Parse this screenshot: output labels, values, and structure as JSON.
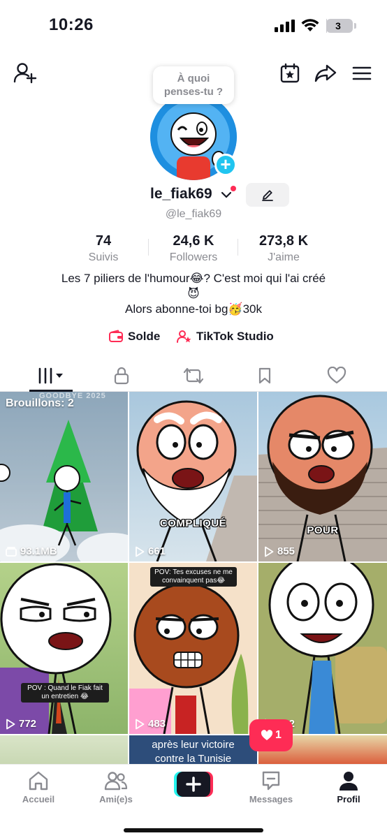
{
  "status_bar": {
    "time": "10:26",
    "battery_label": "3",
    "battery_level": 0.03,
    "icons": [
      "signal-icon",
      "wifi-icon",
      "battery-icon"
    ]
  },
  "top_bar": {
    "icons": [
      "add-friend-icon",
      "calendar-star-icon",
      "share-icon",
      "menu-icon"
    ]
  },
  "profile": {
    "thought_bubble_line1": "À quoi",
    "thought_bubble_line2": "penses-tu ?",
    "username": "le_fiak69",
    "handle": "@le_fiak69",
    "stats": [
      {
        "value": "74",
        "label": "Suivis"
      },
      {
        "value": "24,6 K",
        "label": "Followers"
      },
      {
        "value": "273,8 K",
        "label": "J'aime"
      }
    ],
    "bio_line1": "Les 7 piliers de l'humour😂? C'est moi qui l'ai créé",
    "bio_line2": "😈",
    "bio_line3": "Alors abonne-toi bg🥳30k",
    "links": [
      {
        "label": "Solde"
      },
      {
        "label": "TikTok Studio"
      }
    ]
  },
  "tabs": [
    "videos-grid-icon",
    "lock-icon",
    "repost-icon",
    "bookmark-icon",
    "heart-icon"
  ],
  "grid": {
    "drafts_title": "Brouillons: 2",
    "drafts_bg_text": "GOODBYE 2025",
    "items": [
      {
        "label": "93.1MB",
        "caption": ""
      },
      {
        "label": "661",
        "caption": "COMPLIQUÉ"
      },
      {
        "label": "855",
        "caption": "POUR"
      },
      {
        "label": "772",
        "caption": "",
        "pov": "POV : Quand le Fiak fait un entretien 😂"
      },
      {
        "label": "483",
        "caption": "",
        "pov": "POV: Tes excuses ne me convainquent pas😂"
      },
      {
        "label": "162",
        "caption": ""
      }
    ],
    "partial_caption_line1": "après leur victoire",
    "partial_caption_line2": "contre la Tunisie"
  },
  "like_notification": {
    "count": "1"
  },
  "bottom_nav": [
    {
      "label": "Accueil",
      "icon": "home-icon"
    },
    {
      "label": "Ami(e)s",
      "icon": "friends-icon"
    },
    {
      "label": "",
      "icon": "create-icon"
    },
    {
      "label": "Messages",
      "icon": "messages-icon"
    },
    {
      "label": "Profil",
      "icon": "profile-icon"
    }
  ],
  "colors": {
    "accent": "#fe2c55",
    "teal": "#25f4ee",
    "text": "#161823",
    "muted": "#8a8b91"
  }
}
